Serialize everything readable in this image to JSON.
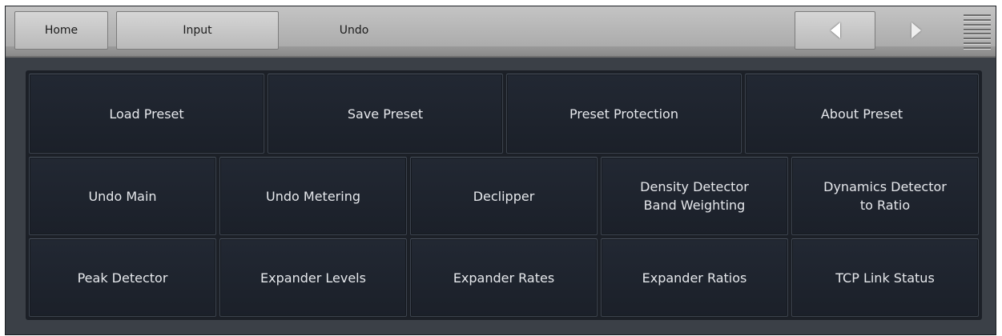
{
  "header": {
    "tabs": [
      {
        "label": "Home"
      },
      {
        "label": "Input"
      },
      {
        "label": "Undo"
      }
    ],
    "nav": {
      "prev_icon": "arrow-left-icon",
      "next_icon": "arrow-right-icon",
      "menu_icon": "menu-icon"
    }
  },
  "preset_row": [
    {
      "label": "Load Preset"
    },
    {
      "label": "Save Preset"
    },
    {
      "label": "Preset Protection"
    },
    {
      "label": "About Preset"
    }
  ],
  "undo_rows": [
    [
      {
        "label": "Undo Main"
      },
      {
        "label": "Undo Metering"
      },
      {
        "label": "Declipper"
      },
      {
        "label": "Density Detector\nBand Weighting"
      },
      {
        "label": "Dynamics Detector\nto Ratio"
      }
    ],
    [
      {
        "label": "Peak Detector"
      },
      {
        "label": "Expander Levels"
      },
      {
        "label": "Expander Rates"
      },
      {
        "label": "Expander Ratios"
      },
      {
        "label": "TCP Link Status"
      }
    ]
  ],
  "colors": {
    "panel_bg": "#1c2027",
    "button_bg": "#1f242d",
    "button_text": "#e6e8ec",
    "topbar_bg": "#b5b5b5"
  }
}
